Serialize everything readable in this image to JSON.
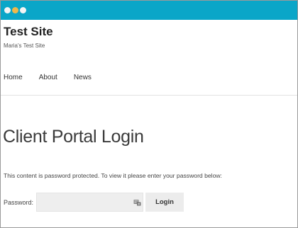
{
  "window": {
    "controls": [
      "close-dot",
      "minimize-dot",
      "zoom-dot"
    ],
    "colors": {
      "titlebar": "#0aa6c8",
      "dot_close": "#f4f4f4",
      "dot_minimize": "#f0b84a",
      "dot_zoom": "#f4f4f4"
    }
  },
  "header": {
    "site_title": "Test Site",
    "tagline": "Maria's Test Site"
  },
  "nav": {
    "items": [
      {
        "label": "Home"
      },
      {
        "label": "About"
      },
      {
        "label": "News"
      }
    ]
  },
  "main": {
    "page_title": "Client Portal Login",
    "notice": "This content is password protected. To view it please enter your password below:",
    "form": {
      "password_label": "Password:",
      "password_value": "",
      "password_placeholder": "",
      "password_icon": "password-manager-icon",
      "login_label": "Login"
    }
  }
}
